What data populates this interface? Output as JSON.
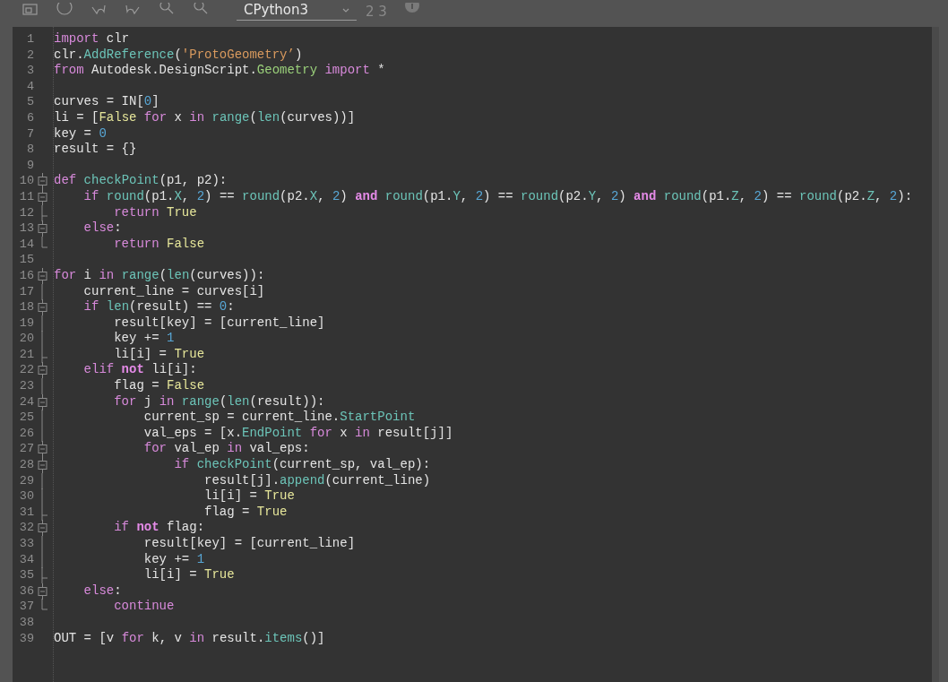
{
  "toolbar": {
    "engine_dropdown": {
      "value": "CPython3"
    },
    "counter": "2 3"
  },
  "editor": {
    "lines": [
      {
        "number": "1",
        "tokens": [
          {
            "kind": "kw",
            "text": "import"
          },
          {
            "kind": "plain",
            "text": " clr"
          }
        ]
      },
      {
        "number": "2",
        "tokens": [
          {
            "kind": "plain",
            "text": "clr."
          },
          {
            "kind": "fn",
            "text": "AddReference"
          },
          {
            "kind": "plain",
            "text": "("
          },
          {
            "kind": "str",
            "text": "'ProtoGeometry’"
          },
          {
            "kind": "plain",
            "text": ")"
          }
        ]
      },
      {
        "number": "3",
        "tokens": [
          {
            "kind": "kw",
            "text": "from"
          },
          {
            "kind": "plain",
            "text": " Autodesk.DesignScript."
          },
          {
            "kind": "cls",
            "text": "Geometry"
          },
          {
            "kind": "kw",
            "text": " import"
          },
          {
            "kind": "plain",
            "text": " *"
          }
        ]
      },
      {
        "number": "4"
      },
      {
        "number": "5",
        "tokens": [
          {
            "kind": "plain",
            "text": "curves = IN["
          },
          {
            "kind": "num",
            "text": "0"
          },
          {
            "kind": "plain",
            "text": "]"
          }
        ]
      },
      {
        "number": "6",
        "tokens": [
          {
            "kind": "plain",
            "text": "li = ["
          },
          {
            "kind": "const",
            "text": "False"
          },
          {
            "kind": "kw",
            "text": " for"
          },
          {
            "kind": "plain",
            "text": " x "
          },
          {
            "kind": "kw",
            "text": "in"
          },
          {
            "kind": "fn",
            "text": " range"
          },
          {
            "kind": "plain",
            "text": "("
          },
          {
            "kind": "fn",
            "text": "len"
          },
          {
            "kind": "plain",
            "text": "(curves))]"
          }
        ]
      },
      {
        "number": "7",
        "tokens": [
          {
            "kind": "plain",
            "text": "key = "
          },
          {
            "kind": "num",
            "text": "0"
          }
        ]
      },
      {
        "number": "8",
        "tokens": [
          {
            "kind": "plain",
            "text": "result = {}"
          }
        ]
      },
      {
        "number": "9"
      },
      {
        "number": "10",
        "kind": "fold-start",
        "tokens": [
          {
            "kind": "kw",
            "text": "def"
          },
          {
            "kind": "fn",
            "text": " checkPoint"
          },
          {
            "kind": "plain",
            "text": "(p1, p2):"
          }
        ]
      },
      {
        "number": "11",
        "kind": "fold-start",
        "tokens": [
          {
            "kind": "kw",
            "text": "    if"
          },
          {
            "kind": "fn",
            "text": " round"
          },
          {
            "kind": "plain",
            "text": "(p1."
          },
          {
            "kind": "fn",
            "text": "X"
          },
          {
            "kind": "plain",
            "text": ", "
          },
          {
            "kind": "num",
            "text": "2"
          },
          {
            "kind": "plain",
            "text": ") == "
          },
          {
            "kind": "fn",
            "text": "round"
          },
          {
            "kind": "plain",
            "text": "(p2."
          },
          {
            "kind": "fn",
            "text": "X"
          },
          {
            "kind": "plain",
            "text": ", "
          },
          {
            "kind": "num",
            "text": "2"
          },
          {
            "kind": "plain",
            "text": ") "
          },
          {
            "kind": "kwb",
            "text": "and"
          },
          {
            "kind": "fn",
            "text": " round"
          },
          {
            "kind": "plain",
            "text": "(p1."
          },
          {
            "kind": "fn",
            "text": "Y"
          },
          {
            "kind": "plain",
            "text": ", "
          },
          {
            "kind": "num",
            "text": "2"
          },
          {
            "kind": "plain",
            "text": ") == "
          },
          {
            "kind": "fn",
            "text": "round"
          },
          {
            "kind": "plain",
            "text": "(p2."
          },
          {
            "kind": "fn",
            "text": "Y"
          },
          {
            "kind": "plain",
            "text": ", "
          },
          {
            "kind": "num",
            "text": "2"
          },
          {
            "kind": "plain",
            "text": ") "
          },
          {
            "kind": "kwb",
            "text": "and"
          },
          {
            "kind": "fn",
            "text": " round"
          },
          {
            "kind": "plain",
            "text": "(p1."
          },
          {
            "kind": "fn",
            "text": "Z"
          },
          {
            "kind": "plain",
            "text": ", "
          },
          {
            "kind": "num",
            "text": "2"
          },
          {
            "kind": "plain",
            "text": ") == "
          },
          {
            "kind": "fn",
            "text": "round"
          },
          {
            "kind": "plain",
            "text": "(p2."
          },
          {
            "kind": "fn",
            "text": "Z"
          },
          {
            "kind": "plain",
            "text": ", "
          },
          {
            "kind": "num",
            "text": "2"
          },
          {
            "kind": "plain",
            "text": "):"
          }
        ]
      },
      {
        "number": "12",
        "kind": "fold-branch",
        "tokens": [
          {
            "kind": "kw",
            "text": "        return"
          },
          {
            "kind": "const",
            "text": " True"
          }
        ]
      },
      {
        "number": "13",
        "kind": "fold-start",
        "tokens": [
          {
            "kind": "kw",
            "text": "    else"
          },
          {
            "kind": "plain",
            "text": ":"
          }
        ]
      },
      {
        "number": "14",
        "kind": "fold-end",
        "tokens": [
          {
            "kind": "kw",
            "text": "        return"
          },
          {
            "kind": "const",
            "text": " False"
          }
        ]
      },
      {
        "number": "15"
      },
      {
        "number": "16",
        "kind": "fold-start",
        "tokens": [
          {
            "kind": "kw",
            "text": "for"
          },
          {
            "kind": "plain",
            "text": " i "
          },
          {
            "kind": "kw",
            "text": "in"
          },
          {
            "kind": "fn",
            "text": " range"
          },
          {
            "kind": "plain",
            "text": "("
          },
          {
            "kind": "fn",
            "text": "len"
          },
          {
            "kind": "plain",
            "text": "(curves)):"
          }
        ]
      },
      {
        "number": "17",
        "kind": "fold-body",
        "tokens": [
          {
            "kind": "plain",
            "text": "    current_line = curves[i]"
          }
        ]
      },
      {
        "number": "18",
        "kind": "fold-start",
        "tokens": [
          {
            "kind": "kw",
            "text": "    if"
          },
          {
            "kind": "fn",
            "text": " len"
          },
          {
            "kind": "plain",
            "text": "(result) == "
          },
          {
            "kind": "num",
            "text": "0"
          },
          {
            "kind": "plain",
            "text": ":"
          }
        ]
      },
      {
        "number": "19",
        "kind": "fold-body",
        "tokens": [
          {
            "kind": "plain",
            "text": "        result[key] = [current_line]"
          }
        ]
      },
      {
        "number": "20",
        "kind": "fold-body",
        "tokens": [
          {
            "kind": "plain",
            "text": "        key += "
          },
          {
            "kind": "num",
            "text": "1"
          }
        ]
      },
      {
        "number": "21",
        "kind": "fold-branch",
        "tokens": [
          {
            "kind": "plain",
            "text": "        li[i] = "
          },
          {
            "kind": "const",
            "text": "True"
          }
        ]
      },
      {
        "number": "22",
        "kind": "fold-start",
        "tokens": [
          {
            "kind": "kw",
            "text": "    elif"
          },
          {
            "kind": "kwb",
            "text": " not"
          },
          {
            "kind": "plain",
            "text": " li[i]:"
          }
        ]
      },
      {
        "number": "23",
        "kind": "fold-body",
        "tokens": [
          {
            "kind": "plain",
            "text": "        flag = "
          },
          {
            "kind": "const",
            "text": "False"
          }
        ]
      },
      {
        "number": "24",
        "kind": "fold-start",
        "tokens": [
          {
            "kind": "kw",
            "text": "        for"
          },
          {
            "kind": "plain",
            "text": " j "
          },
          {
            "kind": "kw",
            "text": "in"
          },
          {
            "kind": "fn",
            "text": " range"
          },
          {
            "kind": "plain",
            "text": "("
          },
          {
            "kind": "fn",
            "text": "len"
          },
          {
            "kind": "plain",
            "text": "(result)):"
          }
        ]
      },
      {
        "number": "25",
        "kind": "fold-body",
        "tokens": [
          {
            "kind": "plain",
            "text": "            current_sp = current_line."
          },
          {
            "kind": "fn",
            "text": "StartPoint"
          }
        ]
      },
      {
        "number": "26",
        "kind": "fold-body",
        "tokens": [
          {
            "kind": "plain",
            "text": "            val_eps = [x."
          },
          {
            "kind": "fn",
            "text": "EndPoint"
          },
          {
            "kind": "kw",
            "text": " for"
          },
          {
            "kind": "plain",
            "text": " x "
          },
          {
            "kind": "kw",
            "text": "in"
          },
          {
            "kind": "plain",
            "text": " result[j]]"
          }
        ]
      },
      {
        "number": "27",
        "kind": "fold-start",
        "tokens": [
          {
            "kind": "kw",
            "text": "            for"
          },
          {
            "kind": "plain",
            "text": " val_ep "
          },
          {
            "kind": "kw",
            "text": "in"
          },
          {
            "kind": "plain",
            "text": " val_eps:"
          }
        ]
      },
      {
        "number": "28",
        "kind": "fold-start",
        "tokens": [
          {
            "kind": "kw",
            "text": "                if"
          },
          {
            "kind": "fn",
            "text": " checkPoint"
          },
          {
            "kind": "plain",
            "text": "(current_sp, val_ep):"
          }
        ]
      },
      {
        "number": "29",
        "kind": "fold-body",
        "tokens": [
          {
            "kind": "plain",
            "text": "                    result[j]."
          },
          {
            "kind": "fn",
            "text": "append"
          },
          {
            "kind": "plain",
            "text": "(current_line)"
          }
        ]
      },
      {
        "number": "30",
        "kind": "fold-body",
        "tokens": [
          {
            "kind": "plain",
            "text": "                    li[i] = "
          },
          {
            "kind": "const",
            "text": "True"
          }
        ]
      },
      {
        "number": "31",
        "kind": "fold-branch",
        "tokens": [
          {
            "kind": "plain",
            "text": "                    flag = "
          },
          {
            "kind": "const",
            "text": "True"
          }
        ]
      },
      {
        "number": "32",
        "kind": "fold-start",
        "tokens": [
          {
            "kind": "kw",
            "text": "        if"
          },
          {
            "kind": "kwb",
            "text": " not"
          },
          {
            "kind": "plain",
            "text": " flag:"
          }
        ]
      },
      {
        "number": "33",
        "kind": "fold-body",
        "tokens": [
          {
            "kind": "plain",
            "text": "            result[key] = [current_line]"
          }
        ]
      },
      {
        "number": "34",
        "kind": "fold-body",
        "tokens": [
          {
            "kind": "plain",
            "text": "            key += "
          },
          {
            "kind": "num",
            "text": "1"
          }
        ]
      },
      {
        "number": "35",
        "kind": "fold-branch",
        "tokens": [
          {
            "kind": "plain",
            "text": "            li[i] = "
          },
          {
            "kind": "const",
            "text": "True"
          }
        ]
      },
      {
        "number": "36",
        "kind": "fold-start",
        "tokens": [
          {
            "kind": "kw",
            "text": "    else"
          },
          {
            "kind": "plain",
            "text": ":"
          }
        ]
      },
      {
        "number": "37",
        "kind": "fold-end",
        "tokens": [
          {
            "kind": "kw",
            "text": "        continue"
          }
        ]
      },
      {
        "number": "38"
      },
      {
        "number": "39",
        "tokens": [
          {
            "kind": "plain",
            "text": "OUT = [v "
          },
          {
            "kind": "kw",
            "text": "for"
          },
          {
            "kind": "plain",
            "text": " k, v "
          },
          {
            "kind": "kw",
            "text": "in"
          },
          {
            "kind": "plain",
            "text": " result."
          },
          {
            "kind": "fn",
            "text": "items"
          },
          {
            "kind": "plain",
            "text": "()]"
          }
        ]
      }
    ]
  }
}
